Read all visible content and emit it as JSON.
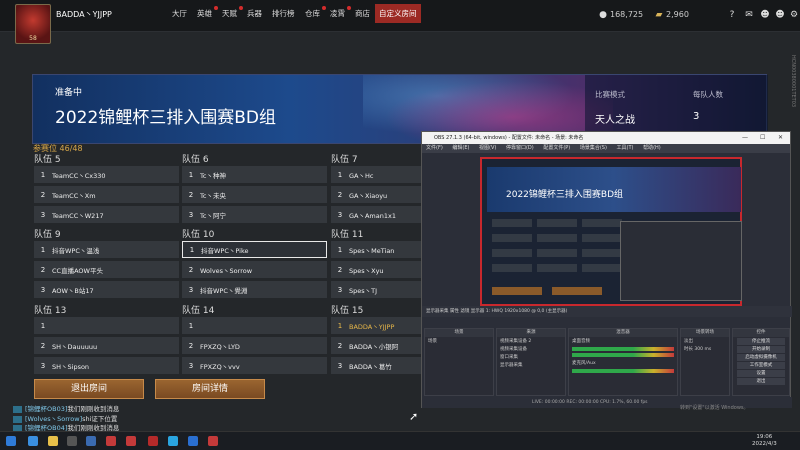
{
  "topbar": {
    "username": "BADDA丶YJJPP",
    "level": "58",
    "nav": [
      "大厅",
      "英雄",
      "天赋",
      "兵器",
      "排行榜",
      "仓库",
      "凌霄",
      "商店"
    ],
    "active_tab": "自定义房间",
    "currency1": "168,725",
    "currency2": "2,960",
    "icons": [
      "help-icon",
      "mail-icon",
      "friends-icon",
      "team-icon",
      "settings-icon"
    ]
  },
  "room": {
    "status": "准备中",
    "title": "2022锦鲤杯三排入围赛BD组",
    "mode_label": "比赛模式",
    "mode_value": "天人之战",
    "size_label": "每队人数",
    "size_value": "3",
    "participants_label": "参赛位",
    "participants_value": "46/48"
  },
  "teams": [
    {
      "name": "队伍 5",
      "players": [
        "TeamCC丶Cx330",
        "TeamCC丶Xm",
        "TeamCC丶W217"
      ]
    },
    {
      "name": "队伍 6",
      "players": [
        "Tc丶种神",
        "Tc丶未央",
        "Tc丶阿宁"
      ]
    },
    {
      "name": "队伍 7",
      "players": [
        "GA丶Hc",
        "GA丶Xiaoyu",
        "GA丶Aman1x1"
      ]
    },
    {
      "name": "队伍 9",
      "players": [
        "抖音WPC丶温浅",
        "CC直播AOW平头",
        "AOW丶B站17"
      ]
    },
    {
      "name": "队伍 10",
      "players": [
        "抖音WPC丶Pike",
        "Wolves丶Sorrow",
        "抖音WPC丶覺淵"
      ]
    },
    {
      "name": "队伍 11",
      "players": [
        "Spes丶MeTian",
        "Spes丶Xyu",
        "Spes丶TJ"
      ]
    },
    {
      "name": "队伍 13",
      "players": [
        "",
        "SH丶Dauuuuu",
        "SH丶Sipson"
      ]
    },
    {
      "name": "队伍 14",
      "players": [
        "",
        "FPXZQ丶LYD",
        "FPXZQ丶vvv"
      ]
    },
    {
      "name": "队伍 15",
      "players": [
        "BADDA丶YJJPP",
        "BADDA丶小银阿",
        "BADDA丶葛竹"
      ]
    }
  ],
  "buttons": {
    "leave": "退出房间",
    "details": "房间详情"
  },
  "chat": [
    {
      "sender": "[锦鲤杯OB03]",
      "msg": "我们刚刚收到消息"
    },
    {
      "sender": "[Wolves丶Sorrow]",
      "msg": "shi证下位置"
    },
    {
      "sender": "[锦鲤杯OB04]",
      "msg": "我们刚刚收到消息"
    }
  ],
  "side_code": "HCN00380001TET03",
  "obs": {
    "title": "OBS 27.1.3 (64-bit, windows) - 配置文件: 未命名 - 场景: 未命名",
    "menu": [
      "文件(F)",
      "编辑(E)",
      "视图(V)",
      "停靠窗口(D)",
      "配置文件(P)",
      "场景集合(S)",
      "工具(T)",
      "帮助(H)"
    ],
    "preview_title": "2022锦鲤杯三排入围赛BD组",
    "bar": "显示器采集   属性   滤镜   显示器 1: HWQ 1920x1080 @ 0,0 (主显示器)",
    "docks": [
      {
        "title": "场景",
        "items": [
          "场景"
        ]
      },
      {
        "title": "来源",
        "items": [
          "视频采集设备 2",
          "视频采集设备",
          "窗口采集",
          "显示器采集"
        ]
      },
      {
        "title": "混音器",
        "items": [
          "桌面音频",
          "麦克风/Aux"
        ]
      },
      {
        "title": "场景转场",
        "items": [
          "淡出",
          "时长 300 ms"
        ]
      },
      {
        "title": "控件",
        "items": [
          "停止推流",
          "开始录制",
          "启动虚拟摄像机",
          "工作室模式",
          "设置",
          "退出"
        ]
      }
    ],
    "status": "LIVE: 00:00:00   REC: 00:00:00   CPU: 1.7%, 60.00 fps",
    "activate": "转到\"设置\"以激活 Windows。"
  },
  "clock": {
    "time": "19:06",
    "date": "2022/4/3"
  }
}
